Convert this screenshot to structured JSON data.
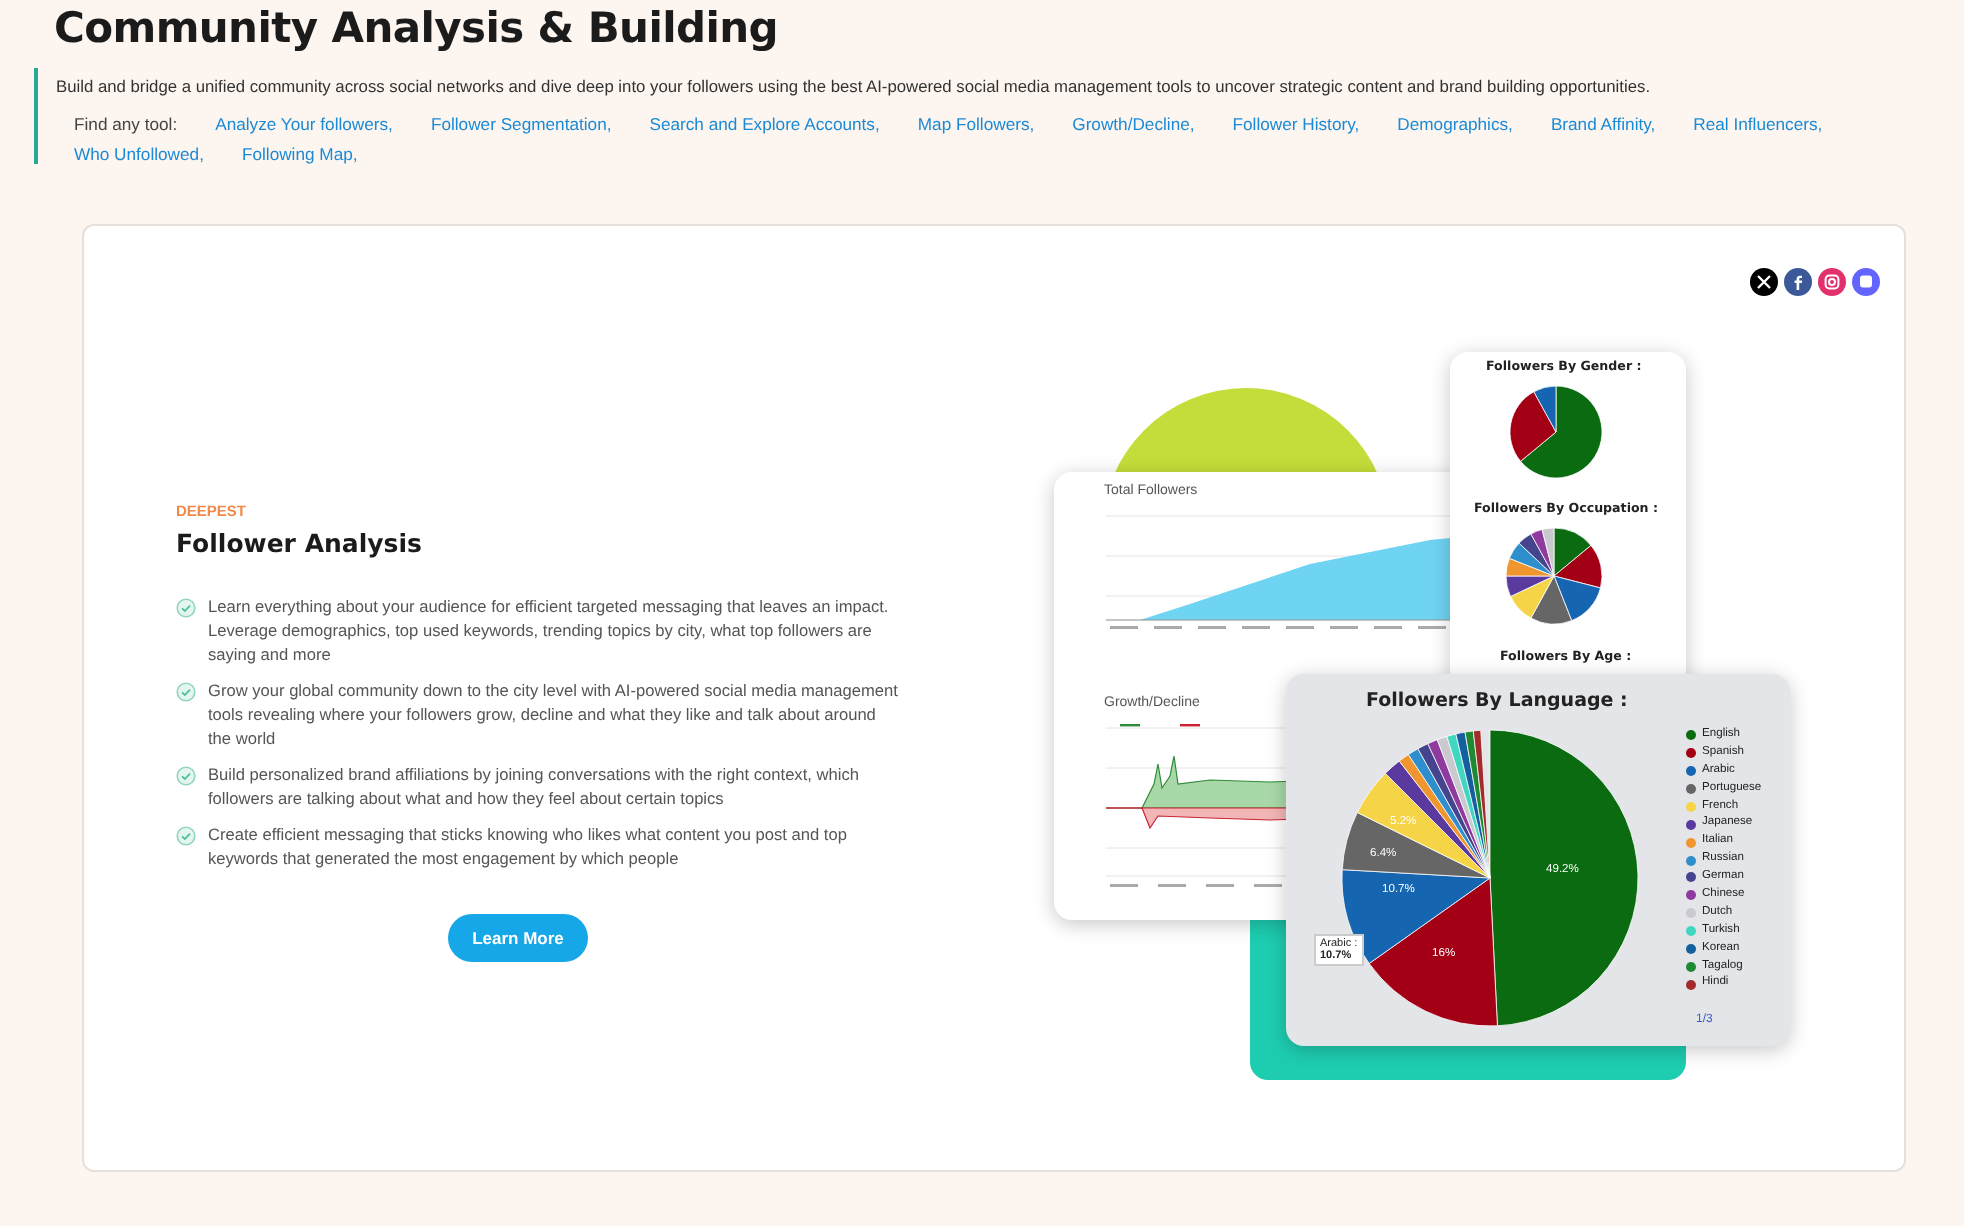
{
  "header": {
    "title": "Community Analysis & Building",
    "description": "Build and bridge a unified community across social networks and dive deep into your followers using the best AI-powered social media management tools to uncover strategic content and brand building opportunities.",
    "tools_label": "Find any tool:",
    "tools": [
      "Analyze Your followers,",
      "Follower Segmentation,",
      "Search and Explore Accounts,",
      "Map Followers,",
      "Growth/Decline,",
      "Follower History,",
      "Demographics,",
      "Brand Affinity,",
      "Real Influencers,",
      "Who Unfollowed,",
      "Following Map,"
    ]
  },
  "feature": {
    "eyebrow": "DEEPEST",
    "title": "Follower Analysis",
    "points": [
      "Learn everything about your audience for efficient targeted messaging that leaves an impact. Leverage demographics, top used keywords, trending topics by city, what top followers are saying and more",
      "Grow your global community down to the city level with AI-powered social media management tools revealing where your followers grow, decline and what they like and talk about around the world",
      "Build personalized brand affiliations by joining conversations with the right context, which followers are talking about what and how they feel about certain topics",
      "Create efficient messaging that sticks knowing who likes what content you post and top keywords that generated the most engagement by which people"
    ],
    "button": "Learn More"
  },
  "illustration": {
    "total_title": "Total Followers",
    "growth_title": "Growth/Decline",
    "gender_title": "Followers By Gender :",
    "occupation_title": "Followers By Occupation :",
    "age_title": "Followers By Age :",
    "language": {
      "title": "Followers By Language :",
      "slice_labels": [
        "49.2%",
        "16%",
        "10.7%",
        "6.4%",
        "5.2%"
      ],
      "tooltip_name": "Arabic :",
      "tooltip_value": "10.7%",
      "pager": "1/3",
      "legend": [
        {
          "name": "English",
          "color": "#0b6b10"
        },
        {
          "name": "Spanish",
          "color": "#a30016"
        },
        {
          "name": "Arabic",
          "color": "#1565b0"
        },
        {
          "name": "Portuguese",
          "color": "#666666"
        },
        {
          "name": "French",
          "color": "#f5d547"
        },
        {
          "name": "Japanese",
          "color": "#5b3aa0"
        },
        {
          "name": "Italian",
          "color": "#f0962e"
        },
        {
          "name": "Russian",
          "color": "#2f8fcc"
        },
        {
          "name": "German",
          "color": "#45458f"
        },
        {
          "name": "Chinese",
          "color": "#8e3a9e"
        },
        {
          "name": "Dutch",
          "color": "#c9c9cf"
        },
        {
          "name": "Turkish",
          "color": "#40d6c0"
        },
        {
          "name": "Korean",
          "color": "#145f9e"
        },
        {
          "name": "Tagalog",
          "color": "#1e8a32"
        },
        {
          "name": "Hindi",
          "color": "#a32b2b"
        }
      ]
    }
  }
}
